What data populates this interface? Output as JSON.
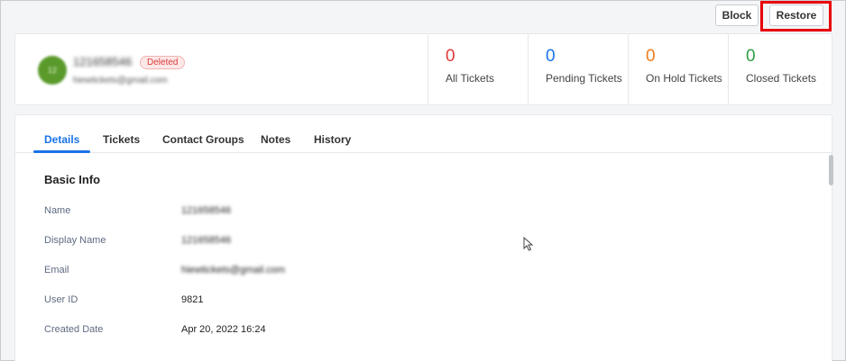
{
  "actions": {
    "block_label": "Block",
    "restore_label": "Restore"
  },
  "contact": {
    "avatar_initials": "12",
    "name": "121658546",
    "email": "hiewtickets@gmail.com",
    "status_badge": "Deleted"
  },
  "stats": [
    {
      "value": "0",
      "label": "All Tickets",
      "color": "#e03a3a"
    },
    {
      "value": "0",
      "label": "Pending Tickets",
      "color": "#1a73e8"
    },
    {
      "value": "0",
      "label": "On Hold Tickets",
      "color": "#f07c1c"
    },
    {
      "value": "0",
      "label": "Closed Tickets",
      "color": "#2e9e44"
    }
  ],
  "tabs": [
    {
      "label": "Details",
      "active": true
    },
    {
      "label": "Tickets",
      "active": false
    },
    {
      "label": "Contact Groups",
      "active": false
    },
    {
      "label": "Notes",
      "active": false
    },
    {
      "label": "History",
      "active": false
    }
  ],
  "basic_info": {
    "title": "Basic Info",
    "fields": [
      {
        "label": "Name",
        "value": "121658546"
      },
      {
        "label": "Display Name",
        "value": "121658546"
      },
      {
        "label": "Email",
        "value": "hiewtickets@gmail.com"
      },
      {
        "label": "User ID",
        "value": "9821"
      },
      {
        "label": "Created Date",
        "value": "Apr 20, 2022 16:24"
      }
    ]
  },
  "colors": {
    "accent": "#1a73e8",
    "highlight": "#e8000b",
    "avatar": "#5a9a2b"
  }
}
